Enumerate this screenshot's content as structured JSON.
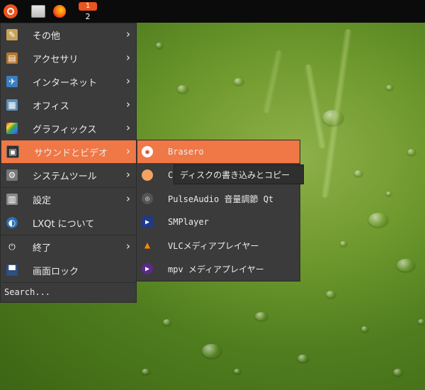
{
  "panel": {
    "workspace_top": "1",
    "workspace_bottom": "2"
  },
  "menu": {
    "items": [
      {
        "label": "その他",
        "icon": "misc-icon"
      },
      {
        "label": "アクセサリ",
        "icon": "accessories-icon"
      },
      {
        "label": "インターネット",
        "icon": "internet-icon"
      },
      {
        "label": "オフィス",
        "icon": "office-icon"
      },
      {
        "label": "グラフィックス",
        "icon": "graphics-icon"
      },
      {
        "label": "サウンドとビデオ",
        "icon": "sound-video-icon"
      },
      {
        "label": "システムツール",
        "icon": "system-tools-icon"
      },
      {
        "label": "設定",
        "icon": "settings-icon"
      },
      {
        "label": "LXQt について",
        "icon": "lxqt-icon"
      },
      {
        "label": "終了",
        "icon": "power-icon"
      },
      {
        "label": "画面ロック",
        "icon": "lock-screen-icon"
      }
    ],
    "search_placeholder": "Search..."
  },
  "submenu": {
    "items": [
      {
        "label": "Brasero",
        "icon": "brasero-icon"
      },
      {
        "label": "Cl",
        "icon": "clementine-icon"
      },
      {
        "label": "PulseAudio 音量調節 Qt",
        "icon": "pulseaudio-icon"
      },
      {
        "label": "SMPlayer",
        "icon": "smplayer-icon"
      },
      {
        "label": "VLCメディアプレイヤー",
        "icon": "vlc-icon"
      },
      {
        "label": "mpv メディアプレイヤー",
        "icon": "mpv-icon"
      }
    ]
  },
  "tooltip": {
    "text": "ディスクの書き込みとコピー"
  },
  "colors": {
    "accent": "#f07746",
    "menu_bg": "#3b3b3b",
    "panel_bg": "#0b0b0b"
  }
}
